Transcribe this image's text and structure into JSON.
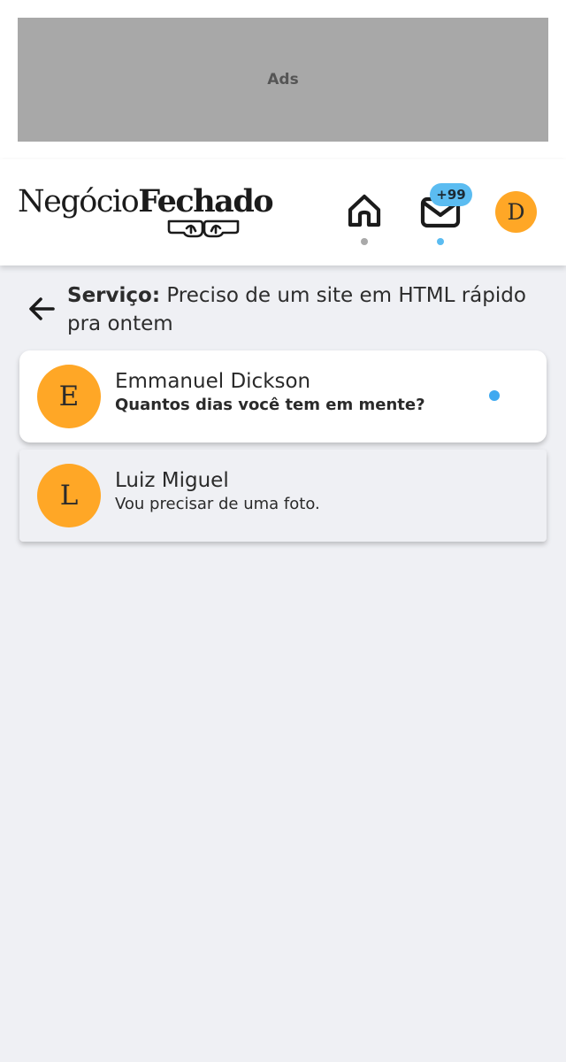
{
  "ads": {
    "label": "Ads"
  },
  "header": {
    "logo": {
      "part1": "Negócio",
      "part2": "Fechado"
    },
    "mail_badge": "+99",
    "user_initial": "D",
    "colors": {
      "accent": "#5bbcf1",
      "avatar": "#ffa726"
    },
    "icons": [
      "home-icon",
      "mail-icon"
    ]
  },
  "service": {
    "label": "Serviço:",
    "title": "Preciso de um site em HTML rápido pra ontem"
  },
  "conversations": [
    {
      "initial": "E",
      "name": "Emmanuel Dickson",
      "last_message": "Quantos dias você tem em mente?",
      "unread": true
    },
    {
      "initial": "L",
      "name": "Luiz Miguel",
      "last_message": "Vou precisar de uma foto.",
      "unread": false
    }
  ]
}
